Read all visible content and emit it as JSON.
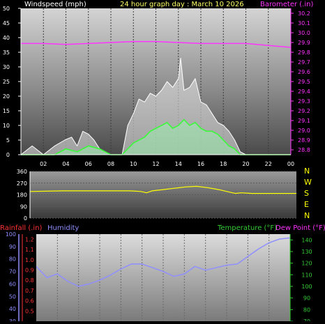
{
  "header": {
    "wind_label": "Windspeed (mph)",
    "title": "24 hour graph day : March 10 2026",
    "baro_label": "Barometer (.in)"
  },
  "dir_letters": [
    "N",
    "W",
    "S",
    "E",
    "N"
  ],
  "bottom_labels": {
    "rain": "Rainfall (.in)",
    "humidity": "Humidity",
    "temperature": "Temperature (°F)",
    "dewpoint": "Dew Point (°F)"
  },
  "colors": {
    "wind_axis": "#ffffff",
    "baro": "#ff33ff",
    "wind_gust": "#ffffff",
    "wind_avg": "#33ff33",
    "wind_dir": "#ffff00",
    "rain": "#ff3333",
    "humidity": "#8f8fff",
    "temperature": "#33cc33",
    "header_title": "#ffff66"
  },
  "chart_data": [
    {
      "type": "line",
      "name": "wind-and-barometer",
      "x_ticks": [
        "02",
        "04",
        "06",
        "08",
        "10",
        "12",
        "14",
        "16",
        "18",
        "20",
        "22",
        "00"
      ],
      "xlim": [
        0,
        24
      ],
      "y_ticks_left": [
        0,
        5,
        10,
        15,
        20,
        25,
        30,
        35,
        40,
        45,
        50
      ],
      "ylim_left": [
        0,
        50
      ],
      "y_ticks_right": [
        28.8,
        28.9,
        29.0,
        29.1,
        29.2,
        29.3,
        29.4,
        29.5,
        29.6,
        29.7,
        29.8,
        29.9,
        30.0,
        30.1,
        30.2
      ],
      "ylim_right": [
        28.75,
        30.25
      ],
      "barometer": {
        "x": [
          0,
          2,
          4,
          6,
          8,
          10,
          12,
          14,
          16,
          18,
          20,
          22,
          24
        ],
        "y": [
          29.89,
          29.89,
          29.88,
          29.89,
          29.9,
          29.91,
          29.91,
          29.9,
          29.89,
          29.89,
          29.89,
          29.87,
          29.85
        ]
      },
      "wind_gust": {
        "x": [
          0,
          1,
          2,
          3,
          3.9,
          4.5,
          5,
          5.5,
          6,
          6.5,
          7,
          8,
          9,
          9.5,
          10,
          10.5,
          11,
          11.5,
          12,
          12.5,
          13,
          13.5,
          14,
          14.2,
          14.5,
          15,
          15.5,
          16,
          16.5,
          17,
          17.5,
          18,
          18.5,
          19,
          19.5,
          20,
          24
        ],
        "y": [
          0,
          3,
          0,
          3,
          5,
          6,
          3,
          8,
          7,
          5,
          2,
          0,
          0,
          10,
          14,
          19,
          18,
          21,
          20,
          22,
          25,
          23,
          26,
          33,
          22,
          23,
          26,
          18,
          17,
          14,
          11,
          10,
          8,
          5,
          1,
          0,
          0
        ]
      },
      "wind_avg": {
        "x": [
          0,
          3,
          4,
          5,
          6,
          7,
          8,
          9,
          9.5,
          10,
          10.5,
          11,
          11.5,
          12,
          12.5,
          13,
          13.5,
          14,
          14.5,
          15,
          15.5,
          16,
          16.5,
          17,
          17.5,
          18,
          18.5,
          19,
          19.5,
          20,
          24
        ],
        "y": [
          0,
          0,
          2,
          1,
          3,
          2,
          0,
          0,
          2,
          4,
          5,
          6,
          8,
          9,
          10,
          11,
          9,
          10,
          12,
          10,
          11,
          9,
          8,
          8,
          7,
          5,
          3,
          2,
          0,
          0,
          0
        ]
      }
    },
    {
      "type": "line",
      "name": "wind-direction",
      "x_ticks": [],
      "xlim": [
        0,
        24
      ],
      "y_ticks": [
        0,
        90,
        180,
        270,
        360
      ],
      "ylim": [
        0,
        360
      ],
      "direction": {
        "x": [
          0,
          3,
          6,
          9,
          10,
          10.5,
          11,
          12,
          13,
          14,
          15,
          16,
          17,
          18,
          18.5,
          19,
          20,
          22,
          24
        ],
        "y": [
          205,
          210,
          210,
          210,
          205,
          195,
          210,
          220,
          230,
          240,
          245,
          235,
          220,
          200,
          190,
          195,
          190,
          190,
          190
        ]
      }
    },
    {
      "type": "line",
      "name": "humidity-temperature",
      "xlim": [
        0,
        24
      ],
      "y_ticks_humidity": [
        30,
        40,
        50,
        60,
        70,
        80,
        90,
        100
      ],
      "ylim_humidity": [
        30,
        100
      ],
      "y_ticks_rain": [
        0.5,
        0.6,
        0.7,
        0.8,
        0.9,
        1.0,
        1.1,
        1.2
      ],
      "ylim_rain": [
        0.4,
        1.25
      ],
      "y_ticks_temp": [
        70,
        80,
        90,
        100,
        110,
        120,
        130,
        140
      ],
      "ylim_temp": [
        70,
        145
      ],
      "humidity": {
        "x": [
          0,
          1,
          2,
          3,
          4,
          5,
          6,
          7,
          8,
          9,
          10,
          11,
          12,
          13,
          14,
          15,
          16,
          17,
          18,
          19,
          20,
          21,
          22,
          23,
          24
        ],
        "y": [
          74,
          65,
          68,
          62,
          58,
          60,
          63,
          67,
          72,
          76,
          76,
          73,
          70,
          66,
          68,
          74,
          71,
          73,
          75,
          76,
          82,
          88,
          93,
          96,
          97
        ]
      }
    }
  ]
}
